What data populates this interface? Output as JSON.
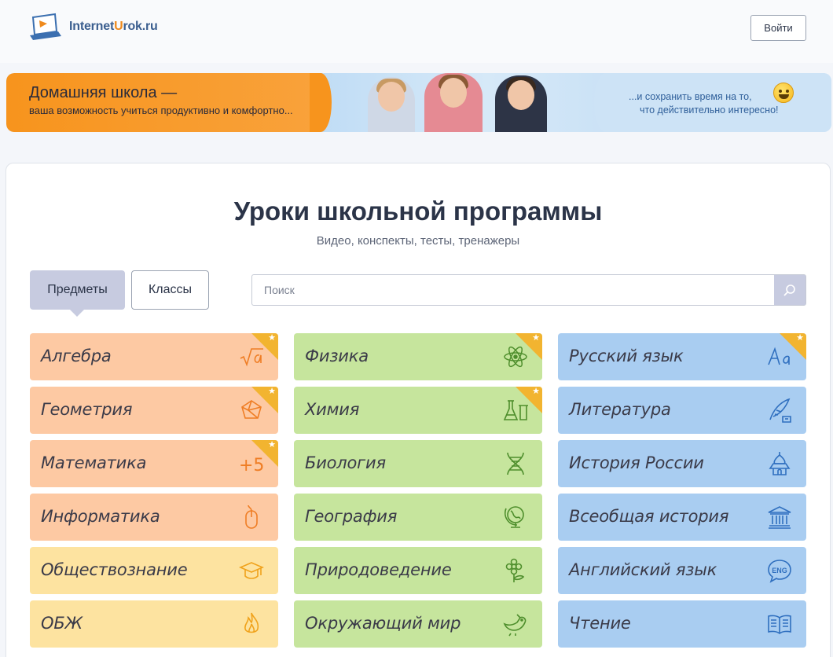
{
  "header": {
    "logo_text_part1": "Internet",
    "logo_text_u": "U",
    "logo_text_part2": "rok.ru",
    "login_label": "Войти"
  },
  "banner": {
    "title": "Домашняя школа —",
    "subtitle": "ваша возможность учиться продуктивно и комфортно...",
    "right_line1": "...и сохранить время на то,",
    "right_line2": "что действительно интересно!"
  },
  "main": {
    "title": "Уроки школьной программы",
    "subtitle": "Видео, конспекты, тесты, тренажеры",
    "tabs": [
      {
        "label": "Предметы",
        "active": true
      },
      {
        "label": "Классы",
        "active": false
      }
    ],
    "search": {
      "placeholder": "Поиск",
      "value": ""
    }
  },
  "subjects": {
    "col1": [
      {
        "label": "Алгебра",
        "icon": "sqrt-icon",
        "color": "#fdc9a3",
        "starred": true
      },
      {
        "label": "Геометрия",
        "icon": "polyhedron-icon",
        "color": "#fdc9a3",
        "starred": true
      },
      {
        "label": "Математика",
        "icon": "plus-five-icon",
        "color": "#fdc9a3",
        "starred": true
      },
      {
        "label": "Информатика",
        "icon": "mouse-icon",
        "color": "#fdc9a3",
        "starred": false
      },
      {
        "label": "Обществознание",
        "icon": "graduation-cap-icon",
        "color": "#fde3a0",
        "starred": false
      },
      {
        "label": "ОБЖ",
        "icon": "fire-icon",
        "color": "#fde3a0",
        "starred": false
      }
    ],
    "col2": [
      {
        "label": "Физика",
        "icon": "atom-icon",
        "color": "#c6e59d",
        "starred": true
      },
      {
        "label": "Химия",
        "icon": "flask-icon",
        "color": "#c6e59d",
        "starred": true
      },
      {
        "label": "Биология",
        "icon": "dna-icon",
        "color": "#c6e59d",
        "starred": false
      },
      {
        "label": "География",
        "icon": "globe-icon",
        "color": "#c6e59d",
        "starred": false
      },
      {
        "label": "Природоведение",
        "icon": "flower-icon",
        "color": "#c6e59d",
        "starred": false
      },
      {
        "label": "Окружающий мир",
        "icon": "bird-icon",
        "color": "#c6e59d",
        "starred": false
      }
    ],
    "col3": [
      {
        "label": "Русский язык",
        "icon": "letters-aa-icon",
        "color": "#a9cdf1",
        "starred": true
      },
      {
        "label": "Литература",
        "icon": "quill-icon",
        "color": "#a9cdf1",
        "starred": false
      },
      {
        "label": "История России",
        "icon": "cathedral-icon",
        "color": "#a9cdf1",
        "starred": false
      },
      {
        "label": "Всеобщая история",
        "icon": "temple-icon",
        "color": "#a9cdf1",
        "starred": false
      },
      {
        "label": "Английский язык",
        "icon": "eng-bubble-icon",
        "color": "#a9cdf1",
        "starred": false
      },
      {
        "label": "Чтение",
        "icon": "book-icon",
        "color": "#a9cdf1",
        "starred": false
      }
    ],
    "plus_five_text": "+5",
    "eng_text": "ENG",
    "star_glyph": "★"
  },
  "colors": {
    "orange_tile": "#fdc9a3",
    "yellow_tile": "#fde3a0",
    "green_tile": "#c6e59d",
    "blue_tile": "#a9cdf1",
    "star": "#f2b430",
    "active_tab": "#c7cbe0"
  }
}
